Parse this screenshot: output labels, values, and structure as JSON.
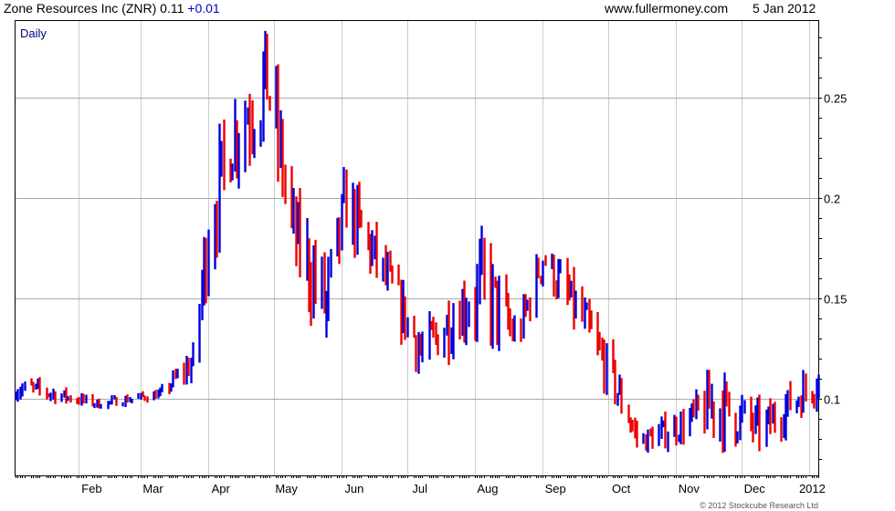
{
  "header": {
    "title": "Zone Resources Inc (ZNR)",
    "price": "0.11",
    "change": "+0.01",
    "website": "www.fullermoney.com",
    "date": "5 Jan 2012"
  },
  "copyright": "© 2012 Stockcube Research Ltd",
  "colors": {
    "up": "#0000dd",
    "down": "#ee0000",
    "grid": "#cccccc",
    "label": "#000080"
  },
  "chart_data": {
    "type": "bar",
    "subtype": "daily-hl-bars",
    "interval_label": "Daily",
    "x_tick_labels": [
      "Feb",
      "Mar",
      "Apr",
      "May",
      "Jun",
      "Jul",
      "Aug",
      "Sep",
      "Oct",
      "Nov",
      "Dec",
      "2012"
    ],
    "y_tick_labels": [
      "0.25",
      "0.2",
      "0.15",
      "0.1"
    ],
    "y_ticks": [
      0.25,
      0.2,
      0.15,
      0.1
    ],
    "ylim": [
      0.062,
      0.288
    ],
    "xlim": [
      "2011-01-03",
      "2012-01-05"
    ],
    "y_axis_side": "right",
    "grid": true,
    "up_color_meaning": "close >= open",
    "key_points": [
      {
        "date": "2011-01-10",
        "high": 0.11,
        "low": 0.1
      },
      {
        "date": "2011-02-10",
        "high": 0.1,
        "low": 0.095
      },
      {
        "date": "2011-03-10",
        "high": 0.105,
        "low": 0.1
      },
      {
        "date": "2011-03-25",
        "high": 0.127,
        "low": 0.11
      },
      {
        "date": "2011-04-01",
        "high": 0.21,
        "low": 0.16
      },
      {
        "date": "2011-04-12",
        "high": 0.25,
        "low": 0.21
      },
      {
        "date": "2011-04-28",
        "high": 0.287,
        "low": 0.23
      },
      {
        "date": "2011-05-10",
        "high": 0.2,
        "low": 0.165
      },
      {
        "date": "2011-05-25",
        "high": 0.17,
        "low": 0.122
      },
      {
        "date": "2011-06-03",
        "high": 0.215,
        "low": 0.18
      },
      {
        "date": "2011-06-20",
        "high": 0.175,
        "low": 0.15
      },
      {
        "date": "2011-07-08",
        "high": 0.135,
        "low": 0.11
      },
      {
        "date": "2011-07-25",
        "high": 0.16,
        "low": 0.13
      },
      {
        "date": "2011-08-05",
        "high": 0.18,
        "low": 0.13
      },
      {
        "date": "2011-08-20",
        "high": 0.14,
        "low": 0.12
      },
      {
        "date": "2011-09-01",
        "high": 0.181,
        "low": 0.16
      },
      {
        "date": "2011-09-20",
        "high": 0.15,
        "low": 0.125
      },
      {
        "date": "2011-10-03",
        "high": 0.12,
        "low": 0.098
      },
      {
        "date": "2011-10-15",
        "high": 0.085,
        "low": 0.072
      },
      {
        "date": "2011-11-05",
        "high": 0.095,
        "low": 0.08
      },
      {
        "date": "2011-11-18",
        "high": 0.115,
        "low": 0.08
      },
      {
        "date": "2011-12-10",
        "high": 0.095,
        "low": 0.075
      },
      {
        "date": "2012-01-05",
        "high": 0.12,
        "low": 0.1
      }
    ]
  }
}
